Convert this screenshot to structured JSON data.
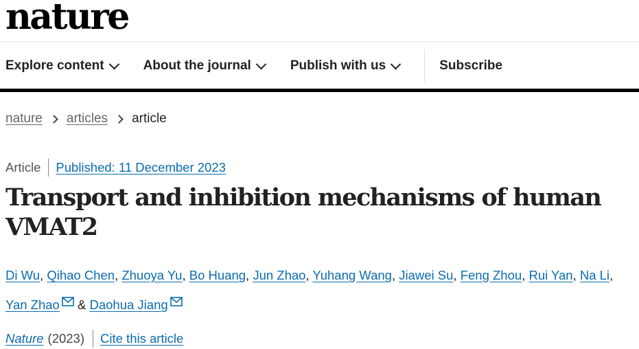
{
  "brand": {
    "logo_text": "nature"
  },
  "nav": {
    "items": [
      {
        "label": "Explore content",
        "has_dropdown": true
      },
      {
        "label": "About the journal",
        "has_dropdown": true
      },
      {
        "label": "Publish with us",
        "has_dropdown": true
      }
    ],
    "subscribe_label": "Subscribe"
  },
  "breadcrumb": [
    {
      "label": "nature",
      "link": true
    },
    {
      "label": "articles",
      "link": true
    },
    {
      "label": "article",
      "link": false
    }
  ],
  "article": {
    "type": "Article",
    "published": "Published: 11 December 2023",
    "title": "Transport and inhibition mechanisms of human VMAT2",
    "authors": [
      {
        "name": "Di Wu",
        "email": false
      },
      {
        "name": "Qihao Chen",
        "email": false
      },
      {
        "name": "Zhuoya Yu",
        "email": false
      },
      {
        "name": "Bo Huang",
        "email": false
      },
      {
        "name": "Jun Zhao",
        "email": false
      },
      {
        "name": "Yuhang Wang",
        "email": false
      },
      {
        "name": "Jiawei Su",
        "email": false
      },
      {
        "name": "Feng Zhou",
        "email": false
      },
      {
        "name": "Rui Yan",
        "email": false
      },
      {
        "name": "Na Li",
        "email": false
      },
      {
        "name": "Yan Zhao",
        "email": true
      },
      {
        "name": "Daohua Jiang",
        "email": true
      }
    ],
    "author_separator": ",",
    "author_last_joiner": "&",
    "journal": "Nature",
    "year": "(2023)",
    "cite_label": "Cite this article"
  },
  "colors": {
    "link": "#0a6cb0",
    "text": "#222222",
    "rule": "#000000"
  }
}
